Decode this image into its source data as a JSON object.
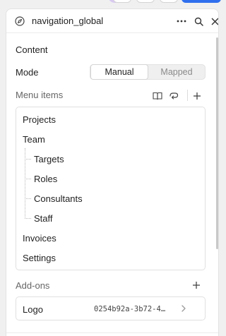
{
  "header": {
    "title": "navigation_global",
    "icons": [
      "compass-icon",
      "more-icon",
      "search-icon",
      "close-icon"
    ]
  },
  "content": {
    "section_label": "Content",
    "mode_label": "Mode",
    "mode_options": [
      "Manual",
      "Mapped"
    ],
    "mode_selected": "Manual"
  },
  "menu": {
    "label": "Menu items",
    "items": [
      {
        "label": "Projects",
        "level": 0
      },
      {
        "label": "Team",
        "level": 0
      },
      {
        "label": "Targets",
        "level": 1
      },
      {
        "label": "Roles",
        "level": 1
      },
      {
        "label": "Consultants",
        "level": 1
      },
      {
        "label": "Staff",
        "level": 1
      },
      {
        "label": "Invoices",
        "level": 0
      },
      {
        "label": "Settings",
        "level": 0
      }
    ]
  },
  "addons": {
    "label": "Add-ons",
    "items": [
      {
        "name": "Logo",
        "id": "0254b92a-3b72-4…"
      }
    ]
  }
}
